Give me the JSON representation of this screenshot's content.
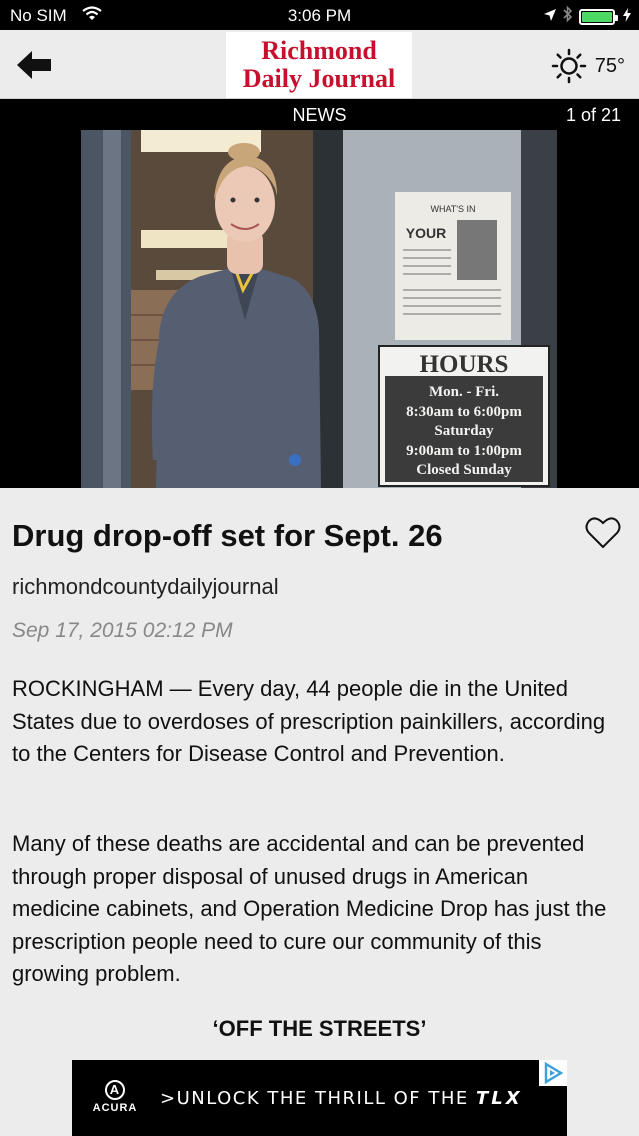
{
  "status": {
    "carrier": "No SIM",
    "time": "3:06 PM"
  },
  "header": {
    "logo_line1": "Richmond",
    "logo_line2": "Daily Journal",
    "temperature": "75°",
    "weather_icon": "sun-icon"
  },
  "section": {
    "label": "NEWS",
    "pager": "1 of 21"
  },
  "photo": {
    "sign_heading": "HOURS",
    "sign_line1": "Mon. - Fri.",
    "sign_line2": "8:30am to 6:00pm",
    "sign_line3": "Saturday",
    "sign_line4": "9:00am to 1:00pm",
    "sign_line5": "Closed Sunday",
    "flyer_line1": "WHAT'S IN",
    "flyer_line2": "YOUR"
  },
  "article": {
    "headline": "Drug drop-off set for Sept. 26",
    "source": "richmondcountydailyjournal",
    "date": "Sep 17, 2015 02:12 PM",
    "paragraph1": "ROCKINGHAM — Every day, 44 people die in the United States due to overdoses of prescription painkillers, according to the Centers for Disease Control and Prevention.",
    "paragraph2": "Many of these deaths are accidental and can be prevented through proper disposal of unused drugs in American medicine cabinets, and Operation Medicine Drop has just the prescription people need to cure our community of this growing problem.",
    "subhead": "‘OFF THE STREETS’"
  },
  "ad": {
    "brand": "ACURA",
    "copy": ">UNLOCK THE THRILL OF THE",
    "model": "TLX"
  },
  "colors": {
    "logo_red": "#c8102e",
    "battery_green": "#4cd964",
    "adchoices_blue": "#3aa0d8"
  }
}
